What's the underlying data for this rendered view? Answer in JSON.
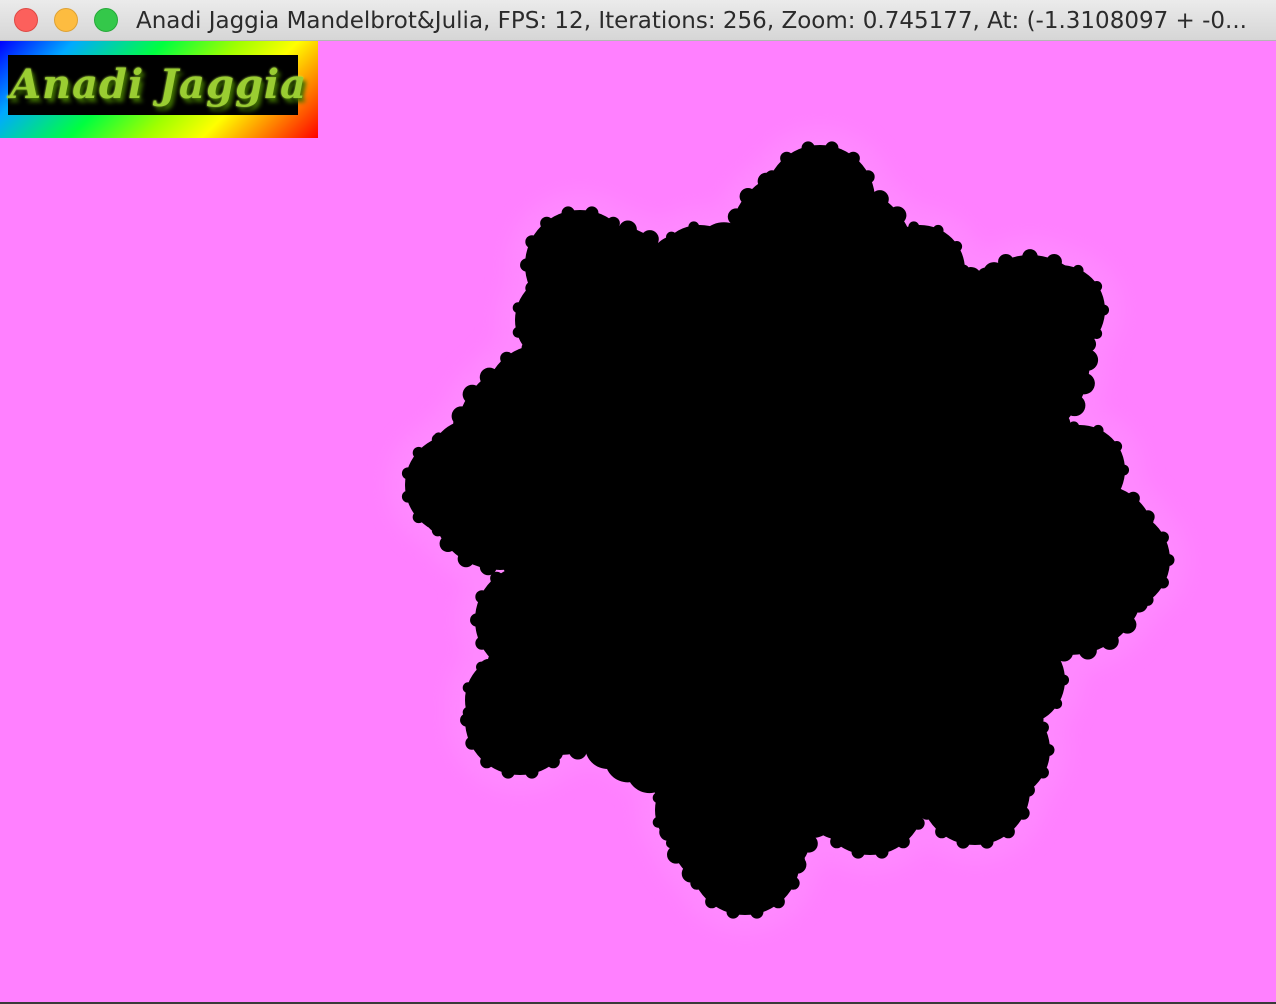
{
  "window": {
    "title": "Anadi Jaggia Mandelbrot&Julia, FPS: 12, Iterations: 256, Zoom: 0.745177, At: (-1.3108097 + -0...",
    "controls": {
      "close": "close-button",
      "minimize": "minimize-button",
      "zoom": "zoom-button"
    }
  },
  "logo": {
    "text": "Anadi Jaggia"
  },
  "render": {
    "background_color": "#ff80ff",
    "set_color": "#000000",
    "glow_color": "#ff90ff"
  }
}
